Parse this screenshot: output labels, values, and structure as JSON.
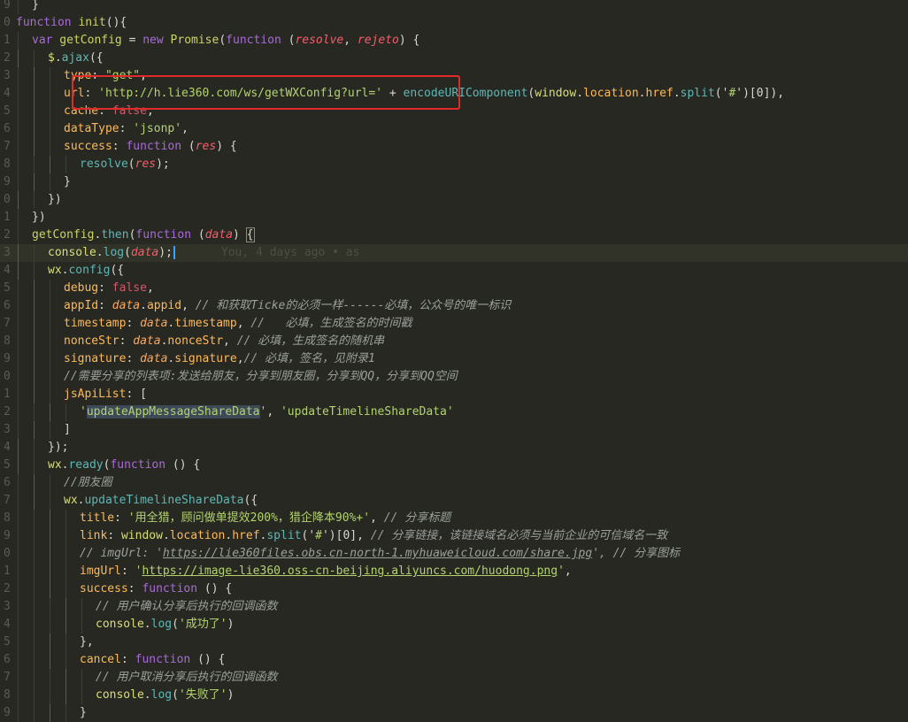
{
  "editor": {
    "gutter": [
      "9",
      "0",
      "1",
      "2",
      "3",
      "4",
      "5",
      "6",
      "7",
      "8",
      "9",
      "0",
      "1",
      "2",
      "3",
      "4",
      "5",
      "6",
      "7",
      "8",
      "9",
      "0",
      "1",
      "2",
      "3",
      "4",
      "5",
      "6",
      "7",
      "8",
      "9",
      "0",
      "1",
      "2",
      "3",
      "4",
      "5",
      "6",
      "7",
      "8",
      "9"
    ],
    "blame": "You, 4 days ago • as",
    "lines": [
      [
        {
          "t": "}",
          "c": "punc"
        }
      ],
      [
        {
          "t": "function",
          "c": "kw"
        },
        {
          "t": " init",
          "c": "fn"
        },
        {
          "t": "(){",
          "c": "punc"
        }
      ],
      [
        {
          "t": "var",
          "c": "kw"
        },
        {
          "t": " getConfig ",
          "c": "fn"
        },
        {
          "t": "= ",
          "c": "punc"
        },
        {
          "t": "new",
          "c": "kw"
        },
        {
          "t": " Promise",
          "c": "fn"
        },
        {
          "t": "(",
          "c": "punc"
        },
        {
          "t": "function",
          "c": "kw"
        },
        {
          "t": " (",
          "c": "punc"
        },
        {
          "t": "resolve",
          "c": "param"
        },
        {
          "t": ", ",
          "c": "punc"
        },
        {
          "t": "rejeto",
          "c": "param"
        },
        {
          "t": ") {",
          "c": "punc"
        }
      ],
      [
        {
          "t": "$",
          "c": "obj"
        },
        {
          "t": ".",
          "c": "punc"
        },
        {
          "t": "ajax",
          "c": "method"
        },
        {
          "t": "({",
          "c": "punc"
        }
      ],
      [
        {
          "t": "type",
          "c": "prop"
        },
        {
          "t": ": ",
          "c": "punc"
        },
        {
          "t": "\"get\"",
          "c": "str"
        },
        {
          "t": ",",
          "c": "punc"
        }
      ],
      [
        {
          "t": "url",
          "c": "prop"
        },
        {
          "t": ": ",
          "c": "punc"
        },
        {
          "t": "'http://h.lie360.com/ws/getWXConfig?url='",
          "c": "str"
        },
        {
          "t": " + ",
          "c": "punc"
        },
        {
          "t": "encodeURIComponent",
          "c": "method"
        },
        {
          "t": "(",
          "c": "punc"
        },
        {
          "t": "window",
          "c": "obj"
        },
        {
          "t": ".",
          "c": "punc"
        },
        {
          "t": "location",
          "c": "prop"
        },
        {
          "t": ".",
          "c": "punc"
        },
        {
          "t": "href",
          "c": "prop"
        },
        {
          "t": ".",
          "c": "punc"
        },
        {
          "t": "split",
          "c": "method"
        },
        {
          "t": "('",
          "c": "punc"
        },
        {
          "t": "#",
          "c": "str"
        },
        {
          "t": "')[0]),",
          "c": "punc"
        }
      ],
      [
        {
          "t": "cache",
          "c": "prop"
        },
        {
          "t": ": ",
          "c": "punc"
        },
        {
          "t": "false",
          "c": "bool"
        },
        {
          "t": ",",
          "c": "punc"
        }
      ],
      [
        {
          "t": "dataType",
          "c": "prop"
        },
        {
          "t": ": ",
          "c": "punc"
        },
        {
          "t": "'jsonp'",
          "c": "str"
        },
        {
          "t": ",",
          "c": "punc"
        }
      ],
      [
        {
          "t": "success",
          "c": "prop"
        },
        {
          "t": ": ",
          "c": "punc"
        },
        {
          "t": "function",
          "c": "kw"
        },
        {
          "t": " (",
          "c": "punc"
        },
        {
          "t": "res",
          "c": "param"
        },
        {
          "t": ") {",
          "c": "punc"
        }
      ],
      [
        {
          "t": "resolve",
          "c": "method"
        },
        {
          "t": "(",
          "c": "punc"
        },
        {
          "t": "res",
          "c": "param"
        },
        {
          "t": ");",
          "c": "punc"
        }
      ],
      [
        {
          "t": "}",
          "c": "punc"
        }
      ],
      [
        {
          "t": "})",
          "c": "punc"
        }
      ],
      [
        {
          "t": "})",
          "c": "punc"
        }
      ],
      [
        {
          "t": "getConfig",
          "c": "fn"
        },
        {
          "t": ".",
          "c": "punc"
        },
        {
          "t": "then",
          "c": "method"
        },
        {
          "t": "(",
          "c": "punc"
        },
        {
          "t": "function",
          "c": "kw"
        },
        {
          "t": " (",
          "c": "punc"
        },
        {
          "t": "data",
          "c": "param"
        },
        {
          "t": ") ",
          "c": "punc"
        },
        {
          "t": "{",
          "c": "punc",
          "x": "bracket"
        }
      ],
      [
        {
          "t": "console",
          "c": "obj"
        },
        {
          "t": ".",
          "c": "punc"
        },
        {
          "t": "log",
          "c": "method"
        },
        {
          "t": "(",
          "c": "punc"
        },
        {
          "t": "data",
          "c": "param"
        },
        {
          "t": ");",
          "c": "punc"
        }
      ],
      [
        {
          "t": "wx",
          "c": "obj"
        },
        {
          "t": ".",
          "c": "punc"
        },
        {
          "t": "config",
          "c": "method"
        },
        {
          "t": "({",
          "c": "punc"
        }
      ],
      [
        {
          "t": "debug",
          "c": "prop"
        },
        {
          "t": ": ",
          "c": "punc"
        },
        {
          "t": "false",
          "c": "bool"
        },
        {
          "t": ",",
          "c": "punc"
        }
      ],
      [
        {
          "t": "appId",
          "c": "prop"
        },
        {
          "t": ": ",
          "c": "punc"
        },
        {
          "t": "data",
          "c": "data"
        },
        {
          "t": ".",
          "c": "punc"
        },
        {
          "t": "appid",
          "c": "prop"
        },
        {
          "t": ", ",
          "c": "punc"
        },
        {
          "t": "// 和获取Ticke的必须一样------必填，公众号的唯一标识",
          "c": "comment"
        }
      ],
      [
        {
          "t": "timestamp",
          "c": "prop"
        },
        {
          "t": ": ",
          "c": "punc"
        },
        {
          "t": "data",
          "c": "data"
        },
        {
          "t": ".",
          "c": "punc"
        },
        {
          "t": "timestamp",
          "c": "prop"
        },
        {
          "t": ", ",
          "c": "punc"
        },
        {
          "t": "//   必填，生成签名的时间戳",
          "c": "comment"
        }
      ],
      [
        {
          "t": "nonceStr",
          "c": "prop"
        },
        {
          "t": ": ",
          "c": "punc"
        },
        {
          "t": "data",
          "c": "data"
        },
        {
          "t": ".",
          "c": "punc"
        },
        {
          "t": "nonceStr",
          "c": "prop"
        },
        {
          "t": ", ",
          "c": "punc"
        },
        {
          "t": "// 必填，生成签名的随机串",
          "c": "comment"
        }
      ],
      [
        {
          "t": "signature",
          "c": "prop"
        },
        {
          "t": ": ",
          "c": "punc"
        },
        {
          "t": "data",
          "c": "data"
        },
        {
          "t": ".",
          "c": "punc"
        },
        {
          "t": "signature",
          "c": "prop"
        },
        {
          "t": ",",
          "c": "punc"
        },
        {
          "t": "// 必填，签名，见附录1",
          "c": "comment"
        }
      ],
      [
        {
          "t": "//需要分享的列表项:发送给朋友，分享到朋友圈，分享到QQ，分享到QQ空间",
          "c": "comment"
        }
      ],
      [
        {
          "t": "jsApiList",
          "c": "prop"
        },
        {
          "t": ": [",
          "c": "punc"
        }
      ],
      [
        {
          "t": "'",
          "c": "str"
        },
        {
          "t": "updateAppMessageShareData",
          "c": "str",
          "x": "sel"
        },
        {
          "t": "'",
          "c": "str"
        },
        {
          "t": ", ",
          "c": "punc"
        },
        {
          "t": "'updateTimelineShareData'",
          "c": "str"
        }
      ],
      [
        {
          "t": "]",
          "c": "punc"
        }
      ],
      [
        {
          "t": "});",
          "c": "punc"
        }
      ],
      [
        {
          "t": "wx",
          "c": "obj"
        },
        {
          "t": ".",
          "c": "punc"
        },
        {
          "t": "ready",
          "c": "method"
        },
        {
          "t": "(",
          "c": "punc"
        },
        {
          "t": "function",
          "c": "kw"
        },
        {
          "t": " () {",
          "c": "punc"
        }
      ],
      [
        {
          "t": "//朋友圈",
          "c": "comment"
        }
      ],
      [
        {
          "t": "wx",
          "c": "obj"
        },
        {
          "t": ".",
          "c": "punc"
        },
        {
          "t": "updateTimelineShareData",
          "c": "method"
        },
        {
          "t": "({",
          "c": "punc"
        }
      ],
      [
        {
          "t": "title",
          "c": "prop"
        },
        {
          "t": ": ",
          "c": "punc"
        },
        {
          "t": "'用全猎，顾问做单提效200%，猎企降本90%+'",
          "c": "str"
        },
        {
          "t": ", ",
          "c": "punc"
        },
        {
          "t": "// 分享标题",
          "c": "comment"
        }
      ],
      [
        {
          "t": "link",
          "c": "prop"
        },
        {
          "t": ": ",
          "c": "punc"
        },
        {
          "t": "window",
          "c": "obj"
        },
        {
          "t": ".",
          "c": "punc"
        },
        {
          "t": "location",
          "c": "prop"
        },
        {
          "t": ".",
          "c": "punc"
        },
        {
          "t": "href",
          "c": "prop"
        },
        {
          "t": ".",
          "c": "punc"
        },
        {
          "t": "split",
          "c": "method"
        },
        {
          "t": "('",
          "c": "punc"
        },
        {
          "t": "#",
          "c": "str"
        },
        {
          "t": "')[0], ",
          "c": "punc"
        },
        {
          "t": "// 分享链接，该链接域名必须与当前企业的可信域名一致",
          "c": "comment"
        }
      ],
      [
        {
          "t": "// imgUrl: '",
          "c": "comment"
        },
        {
          "t": "https://lie360files.obs.cn-north-1.myhuaweicloud.com/share.jpg",
          "c": "comment",
          "x": "link"
        },
        {
          "t": "', // 分享图标",
          "c": "comment"
        }
      ],
      [
        {
          "t": "imgUrl",
          "c": "prop"
        },
        {
          "t": ": ",
          "c": "punc"
        },
        {
          "t": "'",
          "c": "str"
        },
        {
          "t": "https://image-lie360.oss-cn-beijing.aliyuncs.com/huodong.png",
          "c": "strlink"
        },
        {
          "t": "'",
          "c": "str"
        },
        {
          "t": ",",
          "c": "punc"
        }
      ],
      [
        {
          "t": "success",
          "c": "prop"
        },
        {
          "t": ": ",
          "c": "punc"
        },
        {
          "t": "function",
          "c": "kw"
        },
        {
          "t": " () {",
          "c": "punc"
        }
      ],
      [
        {
          "t": "// 用户确认分享后执行的回调函数",
          "c": "comment"
        }
      ],
      [
        {
          "t": "console",
          "c": "obj"
        },
        {
          "t": ".",
          "c": "punc"
        },
        {
          "t": "log",
          "c": "method"
        },
        {
          "t": "(",
          "c": "punc"
        },
        {
          "t": "'成功了'",
          "c": "str"
        },
        {
          "t": ")",
          "c": "punc"
        }
      ],
      [
        {
          "t": "},",
          "c": "punc"
        }
      ],
      [
        {
          "t": "cancel",
          "c": "prop"
        },
        {
          "t": ": ",
          "c": "punc"
        },
        {
          "t": "function",
          "c": "kw"
        },
        {
          "t": " () {",
          "c": "punc"
        }
      ],
      [
        {
          "t": "// 用户取消分享后执行的回调函数",
          "c": "comment"
        }
      ],
      [
        {
          "t": "console",
          "c": "obj"
        },
        {
          "t": ".",
          "c": "punc"
        },
        {
          "t": "log",
          "c": "method"
        },
        {
          "t": "(",
          "c": "punc"
        },
        {
          "t": "'失败了'",
          "c": "str"
        },
        {
          "t": ")",
          "c": "punc"
        }
      ],
      [
        {
          "t": "}",
          "c": "punc"
        }
      ]
    ]
  },
  "colors": {
    "background": "#272822",
    "annotation_border": "#e02b2b",
    "cursor": "#3ba0ff"
  }
}
